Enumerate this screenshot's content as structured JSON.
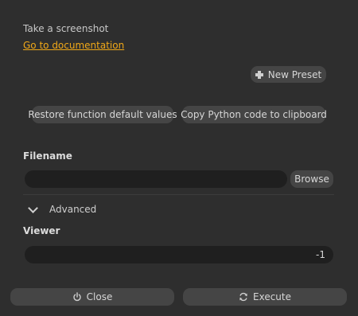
{
  "header": {
    "description": "Take a screenshot",
    "doc_link": "Go to documentation"
  },
  "presets": {
    "new_preset_label": "New Preset"
  },
  "actions": {
    "restore_label": "Restore function default values",
    "copy_label": "Copy Python code to clipboard"
  },
  "filename": {
    "label": "Filename",
    "value": "",
    "browse_label": "Browse"
  },
  "advanced": {
    "label": "Advanced",
    "expanded": true
  },
  "viewer": {
    "label": "Viewer",
    "value": "-1"
  },
  "footer": {
    "close_label": "Close",
    "execute_label": "Execute"
  },
  "colors": {
    "background": "#2e2e2e",
    "button": "#454545",
    "field": "#1f1f1f",
    "link": "#f0a818"
  }
}
